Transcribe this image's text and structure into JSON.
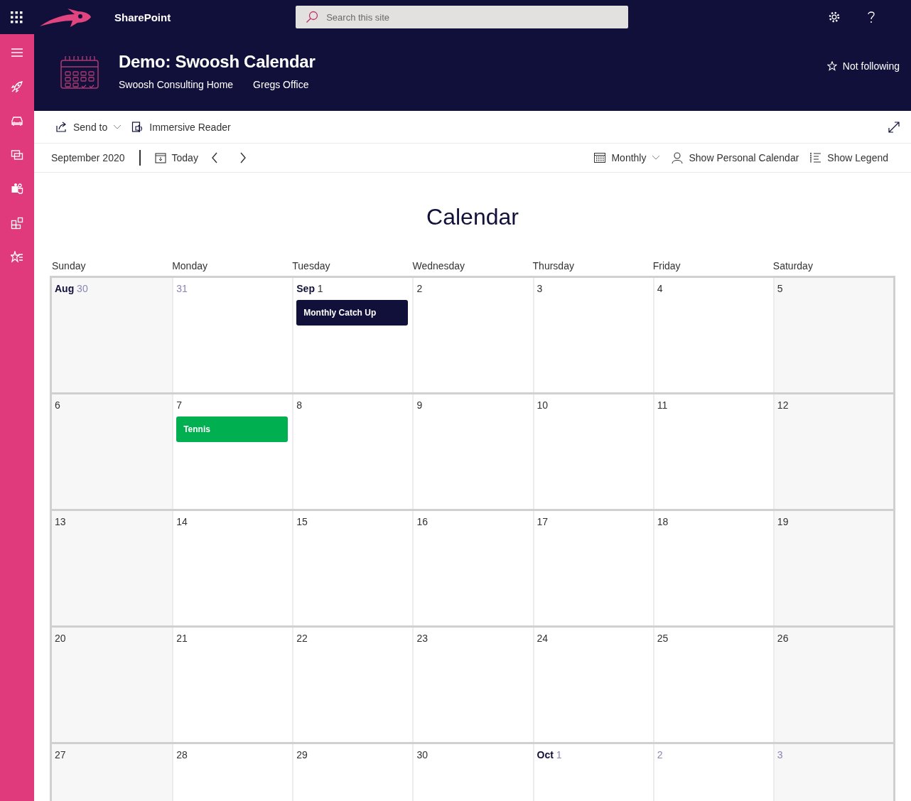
{
  "app": {
    "name": "SharePoint",
    "search": {
      "placeholder": "Search this site"
    }
  },
  "site": {
    "title": "Demo: Swoosh Calendar",
    "links": [
      "Swoosh Consulting Home",
      "Gregs Office"
    ],
    "follow": {
      "label": "Not following",
      "following": false
    }
  },
  "command_bar": {
    "items": [
      {
        "label": "Send to",
        "kind": "share",
        "dropdown": true
      },
      {
        "label": "Immersive Reader",
        "kind": "reader",
        "dropdown": false
      }
    ]
  },
  "toolbar": {
    "period": "September 2020",
    "today": "Today",
    "view": "Monthly",
    "actions": [
      {
        "label": "Show Personal Calendar",
        "kind": "person"
      },
      {
        "label": "Show Legend",
        "kind": "legend"
      }
    ]
  },
  "calendar": {
    "title": "Calendar",
    "weekdays": [
      "Sunday",
      "Monday",
      "Tuesday",
      "Wednesday",
      "Thursday",
      "Friday",
      "Saturday"
    ],
    "weeks": [
      [
        {
          "month": "Aug",
          "day": "30",
          "outside": true
        },
        {
          "day": "31",
          "outside": true
        },
        {
          "month": "Sep",
          "day": "1",
          "outside": false,
          "events": [
            {
              "title": "Monthly Catch Up",
              "color": "#10103a"
            }
          ]
        },
        {
          "day": "2",
          "outside": false
        },
        {
          "day": "3",
          "outside": false
        },
        {
          "day": "4",
          "outside": false
        },
        {
          "day": "5",
          "outside": false
        }
      ],
      [
        {
          "day": "6",
          "outside": false
        },
        {
          "day": "7",
          "outside": false,
          "events": [
            {
              "title": "Tennis",
              "color": "#00b050"
            }
          ]
        },
        {
          "day": "8",
          "outside": false
        },
        {
          "day": "9",
          "outside": false
        },
        {
          "day": "10",
          "outside": false
        },
        {
          "day": "11",
          "outside": false
        },
        {
          "day": "12",
          "outside": false
        }
      ],
      [
        {
          "day": "13",
          "outside": false
        },
        {
          "day": "14",
          "outside": false
        },
        {
          "day": "15",
          "outside": false
        },
        {
          "day": "16",
          "outside": false
        },
        {
          "day": "17",
          "outside": false
        },
        {
          "day": "18",
          "outside": false
        },
        {
          "day": "19",
          "outside": false
        }
      ],
      [
        {
          "day": "20",
          "outside": false
        },
        {
          "day": "21",
          "outside": false
        },
        {
          "day": "22",
          "outside": false
        },
        {
          "day": "23",
          "outside": false
        },
        {
          "day": "24",
          "outside": false
        },
        {
          "day": "25",
          "outside": false
        },
        {
          "day": "26",
          "outside": false
        }
      ],
      [
        {
          "day": "27",
          "outside": false
        },
        {
          "day": "28",
          "outside": false
        },
        {
          "day": "29",
          "outside": false
        },
        {
          "day": "30",
          "outside": false
        },
        {
          "month": "Oct",
          "day": "1",
          "outside": true
        },
        {
          "day": "2",
          "outside": true
        },
        {
          "day": "3",
          "outside": true
        }
      ]
    ]
  }
}
